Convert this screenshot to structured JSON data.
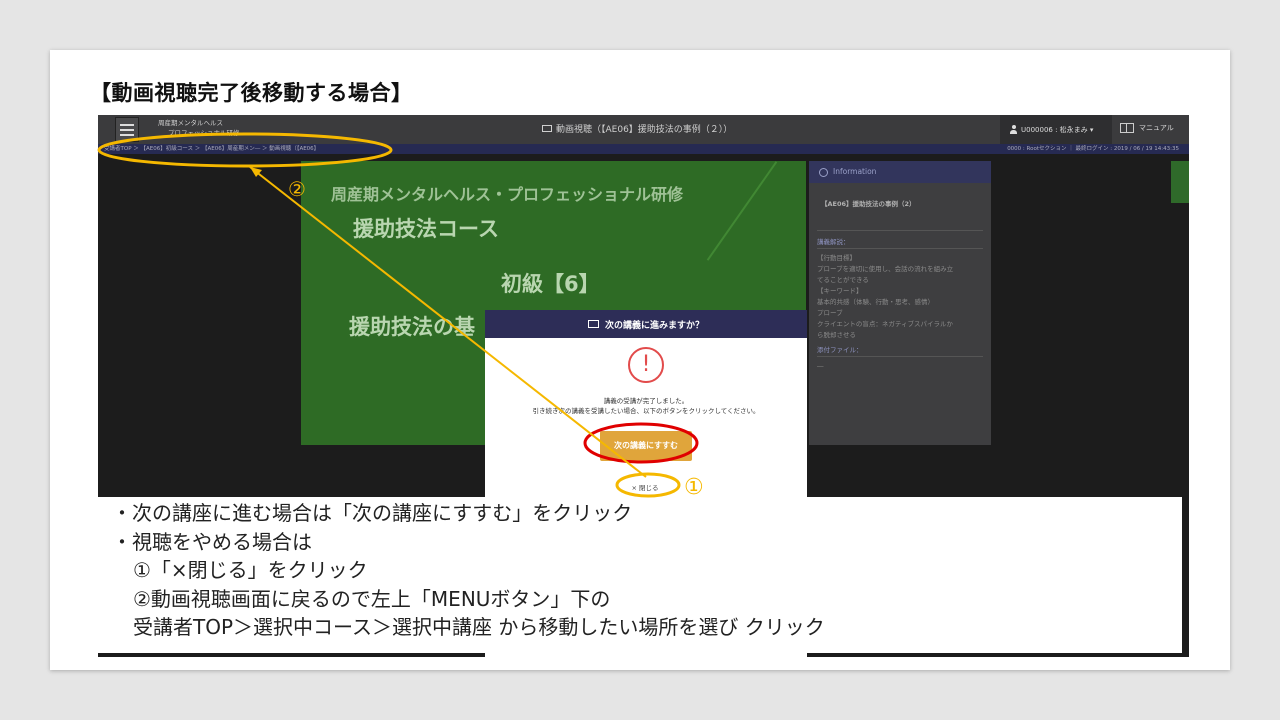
{
  "slide": {
    "title": "【動画視聴完了後移動する場合】"
  },
  "app": {
    "org_line1": "周産期メンタルヘルス",
    "org_line2": "プロフェッショナル研修",
    "page_title": "動画視聴（【AE06】援助技法の事例（２））",
    "user": "U000006 : 松永まみ ▾",
    "manual": "マニュアル",
    "breadcrumb": "受講者TOP ＞ 【AE06】初級コース ＞ 【AE06】周産期メン― ＞ 動画視聴（【AE06】",
    "session_info": "0000 : Rootセクション ｜ 最終ログイン : 2019 / 06 / 19 14:43:35"
  },
  "video": {
    "line1": "周産期メンタルヘルス・プロフェッショナル研修",
    "line2": "援助技法コース",
    "line3": "初級【6】",
    "line4": "援助技法の基"
  },
  "info_panel": {
    "header": "Information",
    "lecture_title": "【AE06】援助技法の事例（2）",
    "section_desc": "講義解説：",
    "desc_lines": [
      "【行動目標】",
      "プローブを適切に使用し、会話の流れを組み立",
      "てることができる",
      "【キーワード】",
      "基本的共感（体験、行動・思考、感情）",
      "プローブ",
      "クライエントの盲点：ネガティブスパイラルか",
      "ら脱却させる"
    ],
    "section_files": "添付ファイル：",
    "files_value": "―"
  },
  "modal": {
    "title": "次の講義に進みますか？",
    "alert_symbol": "!",
    "message_line1": "講義の受講が完了しました。",
    "message_line2": "引き続き次の講義を受講したい場合、以下のボタンをクリックしてください。",
    "next_button": "次の講義にすすむ",
    "close_button": "× 閉じる"
  },
  "annotations": {
    "marker1": "①",
    "marker2": "②",
    "circle_color": "#f5b800",
    "red_circle_color": "#e00000"
  },
  "instructions": {
    "line1": "・次の講座に進む場合は「次の講座にすすむ」をクリック",
    "line2": "・視聴をやめる場合は",
    "line3": "①「×閉じる」をクリック",
    "line4": "②動画視聴画面に戻るので左上「MENUボタン」下の",
    "line5": "受講者TOP＞選択中コース＞選択中講座 から移動したい場所を選び クリック"
  }
}
